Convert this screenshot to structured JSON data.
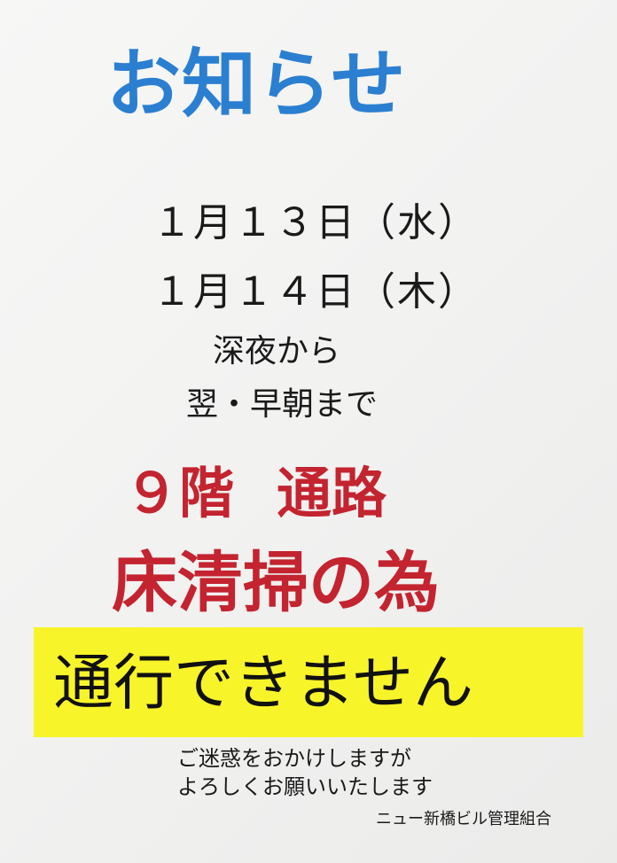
{
  "notice": {
    "title": "お知らせ",
    "dates": [
      "１月１３日（水）",
      "１月１４日（木）"
    ],
    "time_range": [
      "深夜から",
      "翌・早朝まで"
    ],
    "reason": {
      "location_part1": "９階",
      "location_part2": "通路",
      "purpose": "床清掃の為"
    },
    "main_message": "通行できません",
    "apology": [
      "ご迷惑をおかけしますが",
      "よろしくお願いいたします"
    ],
    "organization": "ニュー新橋ビル管理組合"
  },
  "colors": {
    "title": "#2b7fd1",
    "emphasis_red": "#c3242f",
    "highlight_yellow": "#f8f42a",
    "text": "#1a1a1a"
  }
}
